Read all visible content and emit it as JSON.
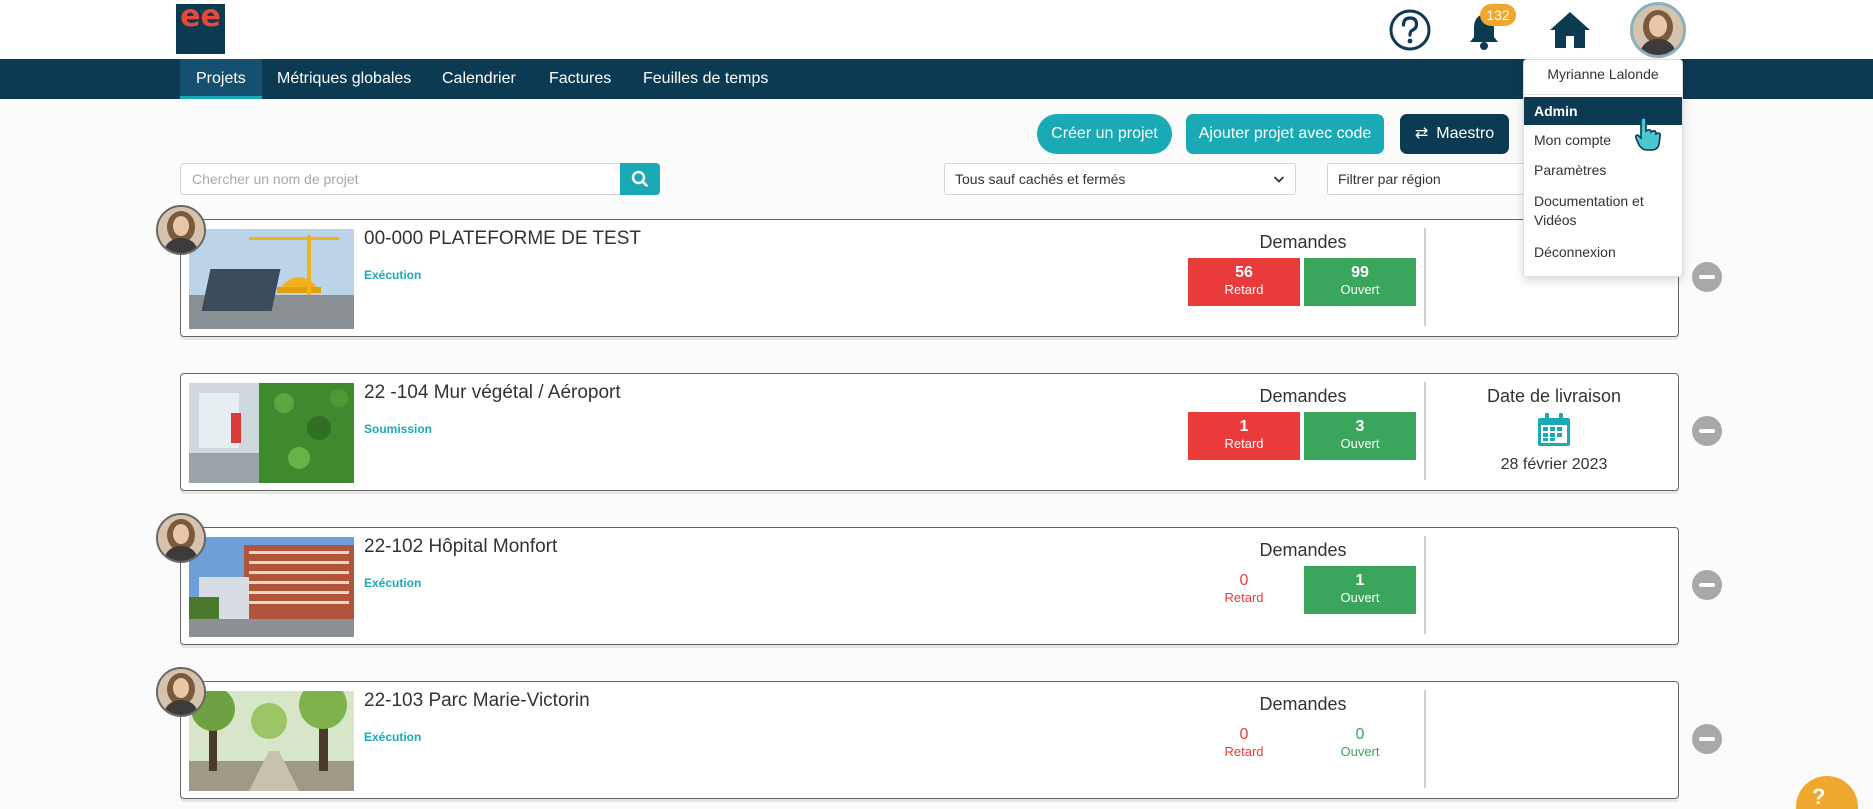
{
  "header": {
    "logo_text": "ee",
    "notification_count": "132",
    "icons": [
      "help-icon",
      "bell-icon",
      "home-icon"
    ]
  },
  "nav": {
    "items": [
      "Projets",
      "Métriques globales",
      "Calendrier",
      "Factures",
      "Feuilles de temps"
    ],
    "active": "Projets"
  },
  "actions": {
    "create": "Créer un projet",
    "add_with_code": "Ajouter projet avec code",
    "maestro": "Maestro"
  },
  "search": {
    "placeholder": "Chercher un nom de projet",
    "value": ""
  },
  "filters": {
    "status_selected": "Tous sauf cachés et fermés",
    "region_placeholder": "Filtrer par région"
  },
  "user_menu": {
    "name": "Myrianne Lalonde",
    "items": [
      "Admin",
      "Mon compte",
      "Paramètres",
      "Documentation et Vidéos",
      "Déconnexion"
    ],
    "active": "Admin"
  },
  "projects": [
    {
      "title": "00-000 PLATEFORME DE TEST",
      "phase": "Exécution",
      "requests_label": "Demandes",
      "late_count": "56",
      "late_label": "Retard",
      "open_count": "99",
      "open_label": "Ouvert",
      "delivery_label": "",
      "delivery_date": ""
    },
    {
      "title": "22 -104 Mur végétal / Aéroport",
      "phase": "Soumission",
      "requests_label": "Demandes",
      "late_count": "1",
      "late_label": "Retard",
      "open_count": "3",
      "open_label": "Ouvert",
      "delivery_label": "Date de livraison",
      "delivery_date": "28 février 2023"
    },
    {
      "title": "22-102 Hôpital Monfort",
      "phase": "Exécution",
      "requests_label": "Demandes",
      "late_count": "0",
      "late_label": "Retard",
      "open_count": "1",
      "open_label": "Ouvert",
      "delivery_label": "",
      "delivery_date": ""
    },
    {
      "title": "22-103 Parc Marie-Victorin",
      "phase": "Exécution",
      "requests_label": "Demandes",
      "late_count": "0",
      "late_label": "Retard",
      "open_count": "0",
      "open_label": "Ouvert",
      "delivery_label": "",
      "delivery_date": ""
    }
  ],
  "colors": {
    "navy": "#0b3a52",
    "teal": "#1aaab5",
    "late_red": "#ea3b3b",
    "open_green": "#3aa65b",
    "badge_orange": "#f0a72d"
  },
  "chat": {
    "label": "?"
  }
}
